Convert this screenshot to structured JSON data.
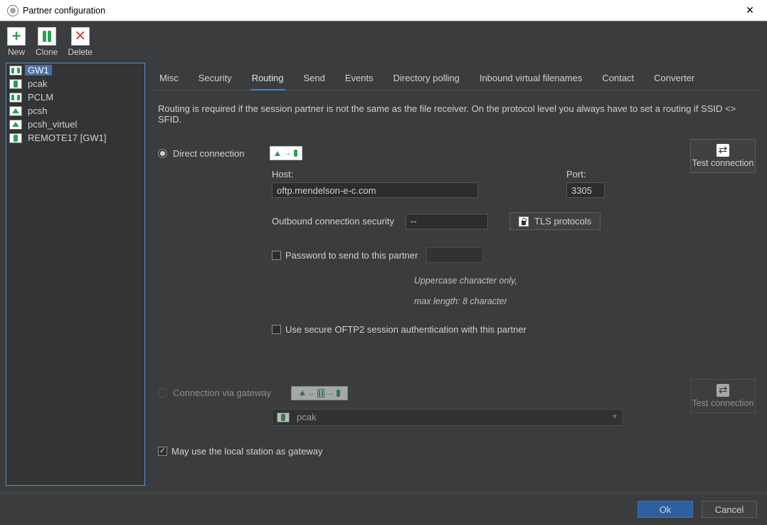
{
  "window": {
    "title": "Partner configuration"
  },
  "toolbar": {
    "new_label": "New",
    "clone_label": "Clone",
    "delete_label": "Delete"
  },
  "sidebar": {
    "items": [
      {
        "label": "GW1",
        "icon": "gw",
        "selected": true
      },
      {
        "label": "pcak",
        "icon": "green"
      },
      {
        "label": "PCLM",
        "icon": "gw"
      },
      {
        "label": "pcsh",
        "icon": "house"
      },
      {
        "label": "pcsh_virtuel",
        "icon": "house"
      },
      {
        "label": "REMOTE17 [GW1]",
        "icon": "green"
      }
    ]
  },
  "tabs": {
    "items": [
      {
        "label": "Misc"
      },
      {
        "label": "Security"
      },
      {
        "label": "Routing",
        "active": true
      },
      {
        "label": "Send"
      },
      {
        "label": "Events"
      },
      {
        "label": "Directory polling"
      },
      {
        "label": "Inbound virtual filenames"
      },
      {
        "label": "Contact"
      },
      {
        "label": "Converter"
      }
    ]
  },
  "routing": {
    "help": "Routing is required if the session partner is not the same as the file receiver. On the protocol level you always have to set a routing if SSID <> SFID.",
    "direct_label": "Direct connection",
    "gateway_label": "Connection via gateway",
    "host_label": "Host:",
    "host_value": "oftp.mendelson-e-c.com",
    "port_label": "Port:",
    "port_value": "3305",
    "outsec_label": "Outbound connection security",
    "outsec_value": "--",
    "tls_btn": "TLS protocols",
    "pw_label": "Password to send to this partner",
    "pw_value": "",
    "pw_hint1": "Uppercase character only,",
    "pw_hint2": "max length: 8 character",
    "secure_oftp2_label": "Use secure OFTP2 session authentication with this partner",
    "gateway_sel": "pcak",
    "local_gw_label": "May use the local station as gateway",
    "test_label": "Test connection"
  },
  "buttons": {
    "ok": "Ok",
    "cancel": "Cancel"
  }
}
